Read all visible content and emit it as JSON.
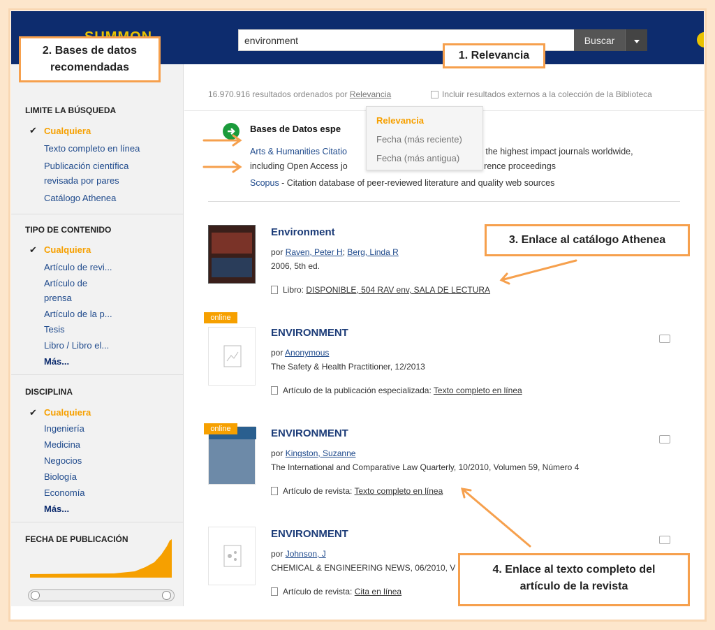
{
  "header": {
    "logo_text": "SUMMON",
    "search_value": "environment",
    "search_button": "Buscar"
  },
  "results_bar": {
    "count_text": "16.970.916 resultados ordenados por",
    "sort_value": "Relevancia",
    "external_label": "Incluir resultados externos a la colección de la Biblioteca"
  },
  "sort_menu": {
    "options": [
      "Relevancia",
      "Fecha (más reciente)",
      "Fecha (más antigua)"
    ]
  },
  "sidebar": {
    "limit": {
      "title": "LIMITE LA BÚSQUEDA",
      "items": [
        "Cualquiera",
        "Texto completo en línea",
        "Publicación científica",
        "revisada por pares",
        "Catálogo Athenea"
      ]
    },
    "content_type": {
      "title": "TIPO DE CONTENIDO",
      "items": [
        "Cualquiera",
        "Artículo de revi...",
        "Artículo de",
        "prensa",
        "Artículo de la p...",
        "Tesis",
        "Libro / Libro el..."
      ],
      "more": "Más..."
    },
    "discipline": {
      "title": "DISCIPLINA",
      "items": [
        "Cualquiera",
        "Ingeniería",
        "Medicina",
        "Negocios",
        "Biología",
        "Economía"
      ],
      "more": "Más..."
    },
    "date": {
      "title": "FECHA DE PUBLICACIÓN"
    }
  },
  "databases": {
    "title": "Bases de Datos espe",
    "line1_link": "Arts & Humanities Citatio",
    "line1_rest": "f the highest impact journals worldwide,",
    "line2": "including Open Access jo",
    "line2_rest": "rence proceedings",
    "line3_link": "Scopus",
    "line3_rest": " - Citation database of peer-reviewed literature and quality web sources"
  },
  "results": [
    {
      "title": "Environment",
      "by": "por",
      "authors": [
        "Raven, Peter H",
        "Berg, Linda R"
      ],
      "source": "2006, 5th ed.",
      "type_label": "Libro:",
      "type_link": "DISPONIBLE, 504 RAV env, SALA DE LECTURA"
    },
    {
      "badge": "online",
      "title": "ENVIRONMENT",
      "by": "por",
      "authors": [
        "Anonymous"
      ],
      "source": "The Safety & Health Practitioner, 12/2013",
      "type_label": "Artículo de la publicación especializada:",
      "type_link": "Texto completo en línea"
    },
    {
      "badge": "online",
      "title": "ENVIRONMENT",
      "by": "por",
      "authors": [
        "Kingston, Suzanne"
      ],
      "source": "The International and Comparative Law Quarterly, 10/2010, Volumen 59, Número 4",
      "type_label": "Artículo de revista:",
      "type_link": "Texto completo en línea"
    },
    {
      "title": "ENVIRONMENT",
      "by": "por",
      "authors": [
        "Johnson, J"
      ],
      "source": "CHEMICAL & ENGINEERING NEWS, 06/2010, V",
      "type_label": "Artículo de revista:",
      "type_link": "Cita en línea"
    }
  ],
  "annotations": {
    "a1": "1. Relevancia",
    "a2_l1": "2. Bases de datos",
    "a2_l2": "recomendadas",
    "a3": "3. Enlace al catálogo Athenea",
    "a4_l1": "4. Enlace al texto completo del",
    "a4_l2": "artículo de la revista"
  },
  "colors": {
    "accent": "#f6a000",
    "header": "#0d2c6e",
    "callout_border": "#f6a04d"
  }
}
